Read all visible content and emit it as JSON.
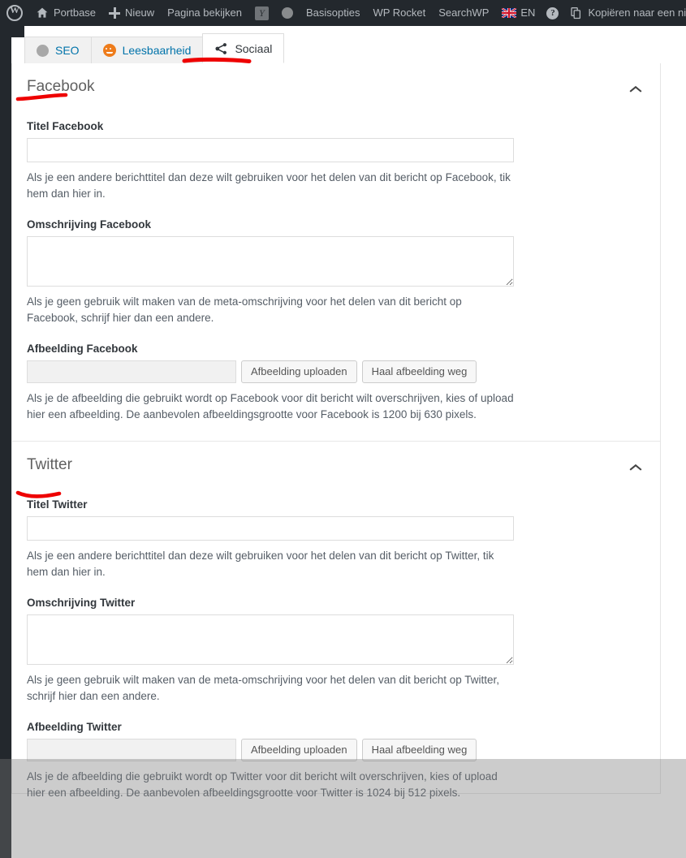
{
  "adminbar": {
    "items": [
      {
        "icon": "wordpress-logo-icon",
        "label": ""
      },
      {
        "icon": "home-icon",
        "label": "Portbase"
      },
      {
        "icon": "plus-icon",
        "label": "Nieuw"
      },
      {
        "icon": "",
        "label": "Pagina bekijken"
      },
      {
        "icon": "yoast-icon",
        "label": ""
      },
      {
        "icon": "seo-score-dot-icon",
        "label": ""
      },
      {
        "icon": "",
        "label": "Basisopties"
      },
      {
        "icon": "",
        "label": "WP Rocket"
      },
      {
        "icon": "",
        "label": "SearchWP"
      },
      {
        "icon": "uk-flag-icon",
        "label": "EN"
      },
      {
        "icon": "help-icon",
        "label": ""
      },
      {
        "icon": "copy-icon",
        "label": "Kopiëren naar een nieuw"
      }
    ]
  },
  "tabs": [
    {
      "label": "SEO",
      "icon": "seo-bullet-icon",
      "active": false
    },
    {
      "label": "Leesbaarheid",
      "icon": "readability-smiley-icon",
      "active": false
    },
    {
      "label": "Sociaal",
      "icon": "share-icon",
      "active": true
    }
  ],
  "sections": [
    {
      "id": "facebook",
      "title": "Facebook",
      "toggle_icon": "chevron-up-icon",
      "title_label": "Titel Facebook",
      "title_value": "",
      "title_help": "Als je een andere berichttitel dan deze wilt gebruiken voor het delen van dit bericht op Facebook, tik hem dan hier in.",
      "desc_label": "Omschrijving Facebook",
      "desc_value": "",
      "desc_help": "Als je geen gebruik wilt maken van de meta-omschrijving voor het delen van dit bericht op Facebook, schrijf hier dan een andere.",
      "image_label": "Afbeelding Facebook",
      "image_value": "",
      "upload_button": "Afbeelding uploaden",
      "remove_button": "Haal afbeelding weg",
      "image_help": "Als je de afbeelding die gebruikt wordt op Facebook voor dit bericht wilt overschrijven, kies of upload hier een afbeelding. De aanbevolen afbeeldingsgrootte voor Facebook is 1200 bij 630 pixels."
    },
    {
      "id": "twitter",
      "title": "Twitter",
      "toggle_icon": "chevron-up-icon",
      "title_label": "Titel Twitter",
      "title_value": "",
      "title_help": "Als je een andere berichttitel dan deze wilt gebruiken voor het delen van dit bericht op Twitter, tik hem dan hier in.",
      "desc_label": "Omschrijving Twitter",
      "desc_value": "",
      "desc_help": "Als je geen gebruik wilt maken van de meta-omschrijving voor het delen van dit bericht op Twitter, schrijf hier dan een andere.",
      "image_label": "Afbeelding Twitter",
      "image_value": "",
      "upload_button": "Afbeelding uploaden",
      "remove_button": "Haal afbeelding weg",
      "image_help": "Als je de afbeelding die gebruikt wordt op Twitter voor dit bericht wilt overschrijven, kies of upload hier een afbeelding. De aanbevolen afbeeldingsgrootte voor Twitter is 1024 bij 512 pixels."
    }
  ],
  "annotations": {
    "color": "#ee0000",
    "marks": [
      "underline-sociaal-tab",
      "underline-facebook-heading",
      "underline-twitter-heading"
    ]
  },
  "colors": {
    "adminbar_bg": "#23282d",
    "accent_link": "#0073aa",
    "panel_bg": "#ffffff",
    "readability_orange": "#ee7c1b",
    "annotation_red": "#ee0000"
  }
}
